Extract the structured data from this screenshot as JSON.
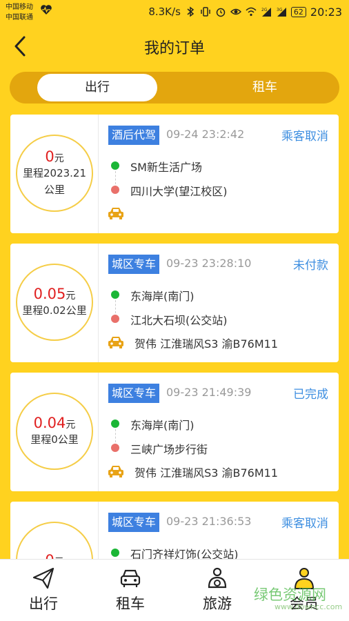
{
  "status_bar": {
    "carrier1": "中国移动",
    "carrier2": "中国联通",
    "net_speed": "8.3K/s",
    "signal_tag_1": "2G",
    "signal_tag_2": "3G",
    "battery": "62",
    "time": "20:23"
  },
  "header": {
    "title": "我的订单",
    "back_icon": "chevron-left-icon"
  },
  "segment": {
    "tabs": [
      {
        "label": "出行",
        "active": true
      },
      {
        "label": "租车",
        "active": false
      }
    ]
  },
  "orders": [
    {
      "amount": "0",
      "unit": "元",
      "distance": "里程2023.21公里",
      "type": "酒后代驾",
      "time": "09-24 23:2:42",
      "status": "乘客取消",
      "from": "SM新生活广场",
      "to": "四川大学(望江校区)",
      "driver": ""
    },
    {
      "amount": "0.05",
      "unit": "元",
      "distance": "里程0.02公里",
      "type": "城区专车",
      "time": "09-23 23:28:10",
      "status": "未付款",
      "from": "东海岸(南门)",
      "to": "江北大石坝(公交站)",
      "driver": "贺伟 江淮瑞风S3 渝B76M11"
    },
    {
      "amount": "0.04",
      "unit": "元",
      "distance": "里程0公里",
      "type": "城区专车",
      "time": "09-23 21:49:39",
      "status": "已完成",
      "from": "东海岸(南门)",
      "to": "三峡广场步行街",
      "driver": "贺伟 江淮瑞风S3 渝B76M11"
    },
    {
      "amount": "0",
      "unit": "元",
      "distance": "",
      "type": "城区专车",
      "time": "09-23 21:36:53",
      "status": "乘客取消",
      "from": "石门齐祥灯饰(公交站)",
      "to": "",
      "driver": ""
    }
  ],
  "bottom_nav": [
    {
      "label": "出行",
      "icon": "paper-plane-icon"
    },
    {
      "label": "租车",
      "icon": "car-icon"
    },
    {
      "label": "旅游",
      "icon": "steering-person-icon"
    },
    {
      "label": "会员",
      "icon": "member-icon"
    }
  ],
  "watermark": {
    "text": "绿色资源网",
    "url": "www.downcc.com"
  },
  "colors": {
    "accent": "#ffd21f",
    "tag_blue": "#3d80e0",
    "status_blue": "#3d8ee0",
    "amount_red": "#e02020",
    "car_orange": "#e8a317"
  }
}
